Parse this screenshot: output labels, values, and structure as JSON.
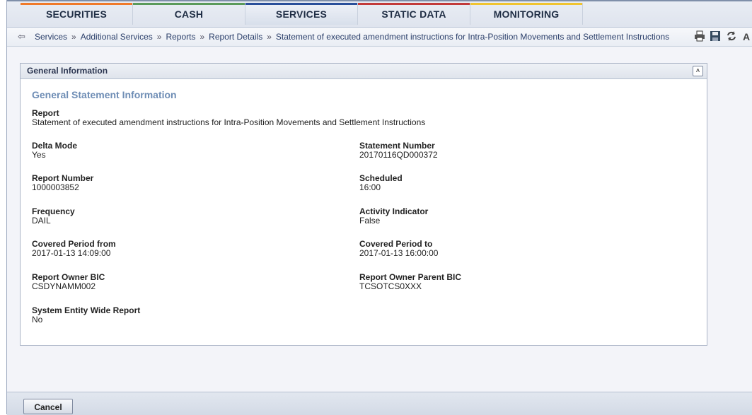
{
  "nav": {
    "tabs": [
      {
        "label": "SECURITIES",
        "color": "#f07a2a"
      },
      {
        "label": "CASH",
        "color": "#5a9a5a"
      },
      {
        "label": "SERVICES",
        "color": "#2a4f9a"
      },
      {
        "label": "STATIC DATA",
        "color": "#c23a3a"
      },
      {
        "label": "MONITORING",
        "color": "#f0c430"
      }
    ],
    "active_tab": "SERVICES"
  },
  "breadcrumb": {
    "back_icon": "back-arrow-icon",
    "items": [
      "Services",
      "Additional Services",
      "Reports",
      "Report Details",
      "Statement of executed amendment instructions for Intra-Position Movements and Settlement Instructions"
    ],
    "separator": "»",
    "tool_icons": [
      "print-icon",
      "save-icon",
      "refresh-icon",
      "font-size-icon"
    ]
  },
  "panel": {
    "title": "General Information",
    "collapse_icon": "collapse-up-icon",
    "section_title": "General Statement Information",
    "report": {
      "label": "Report",
      "value": "Statement of executed amendment instructions for Intra-Position Movements and Settlement Instructions"
    },
    "left_fields": [
      {
        "label": "Delta Mode",
        "value": "Yes"
      },
      {
        "label": "Report Number",
        "value": "1000003852"
      },
      {
        "label": "Frequency",
        "value": "DAIL"
      },
      {
        "label": "Covered Period from",
        "value": "2017-01-13 14:09:00"
      },
      {
        "label": "Report Owner BIC",
        "value": "CSDYNAMM002"
      },
      {
        "label": "System Entity Wide Report",
        "value": "No"
      }
    ],
    "right_fields": [
      {
        "label": "Statement Number",
        "value": "20170116QD000372"
      },
      {
        "label": "Scheduled",
        "value": "16:00"
      },
      {
        "label": "Activity Indicator",
        "value": "False"
      },
      {
        "label": "Covered Period to",
        "value": "2017-01-13 16:00:00"
      },
      {
        "label": "Report Owner Parent BIC",
        "value": "TCSOTCS0XXX"
      }
    ]
  },
  "footer": {
    "cancel_label": "Cancel"
  }
}
